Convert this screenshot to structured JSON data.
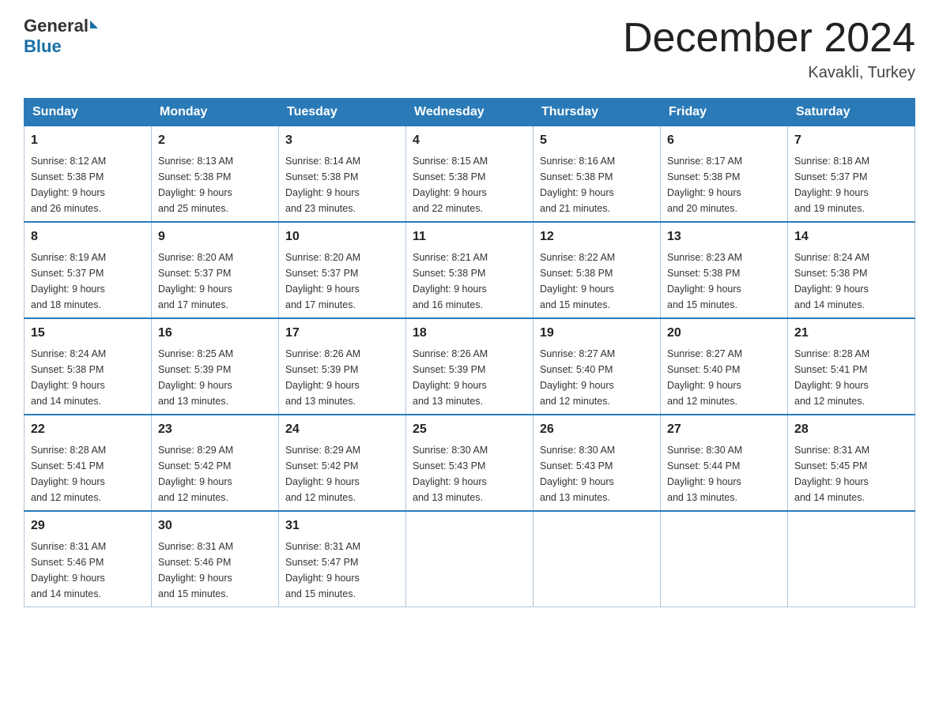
{
  "header": {
    "logo_general": "General",
    "logo_blue": "Blue",
    "month_title": "December 2024",
    "location": "Kavakli, Turkey"
  },
  "weekdays": [
    "Sunday",
    "Monday",
    "Tuesday",
    "Wednesday",
    "Thursday",
    "Friday",
    "Saturday"
  ],
  "weeks": [
    [
      {
        "day": "1",
        "sunrise": "8:12 AM",
        "sunset": "5:38 PM",
        "daylight": "9 hours and 26 minutes."
      },
      {
        "day": "2",
        "sunrise": "8:13 AM",
        "sunset": "5:38 PM",
        "daylight": "9 hours and 25 minutes."
      },
      {
        "day": "3",
        "sunrise": "8:14 AM",
        "sunset": "5:38 PM",
        "daylight": "9 hours and 23 minutes."
      },
      {
        "day": "4",
        "sunrise": "8:15 AM",
        "sunset": "5:38 PM",
        "daylight": "9 hours and 22 minutes."
      },
      {
        "day": "5",
        "sunrise": "8:16 AM",
        "sunset": "5:38 PM",
        "daylight": "9 hours and 21 minutes."
      },
      {
        "day": "6",
        "sunrise": "8:17 AM",
        "sunset": "5:38 PM",
        "daylight": "9 hours and 20 minutes."
      },
      {
        "day": "7",
        "sunrise": "8:18 AM",
        "sunset": "5:37 PM",
        "daylight": "9 hours and 19 minutes."
      }
    ],
    [
      {
        "day": "8",
        "sunrise": "8:19 AM",
        "sunset": "5:37 PM",
        "daylight": "9 hours and 18 minutes."
      },
      {
        "day": "9",
        "sunrise": "8:20 AM",
        "sunset": "5:37 PM",
        "daylight": "9 hours and 17 minutes."
      },
      {
        "day": "10",
        "sunrise": "8:20 AM",
        "sunset": "5:37 PM",
        "daylight": "9 hours and 17 minutes."
      },
      {
        "day": "11",
        "sunrise": "8:21 AM",
        "sunset": "5:38 PM",
        "daylight": "9 hours and 16 minutes."
      },
      {
        "day": "12",
        "sunrise": "8:22 AM",
        "sunset": "5:38 PM",
        "daylight": "9 hours and 15 minutes."
      },
      {
        "day": "13",
        "sunrise": "8:23 AM",
        "sunset": "5:38 PM",
        "daylight": "9 hours and 15 minutes."
      },
      {
        "day": "14",
        "sunrise": "8:24 AM",
        "sunset": "5:38 PM",
        "daylight": "9 hours and 14 minutes."
      }
    ],
    [
      {
        "day": "15",
        "sunrise": "8:24 AM",
        "sunset": "5:38 PM",
        "daylight": "9 hours and 14 minutes."
      },
      {
        "day": "16",
        "sunrise": "8:25 AM",
        "sunset": "5:39 PM",
        "daylight": "9 hours and 13 minutes."
      },
      {
        "day": "17",
        "sunrise": "8:26 AM",
        "sunset": "5:39 PM",
        "daylight": "9 hours and 13 minutes."
      },
      {
        "day": "18",
        "sunrise": "8:26 AM",
        "sunset": "5:39 PM",
        "daylight": "9 hours and 13 minutes."
      },
      {
        "day": "19",
        "sunrise": "8:27 AM",
        "sunset": "5:40 PM",
        "daylight": "9 hours and 12 minutes."
      },
      {
        "day": "20",
        "sunrise": "8:27 AM",
        "sunset": "5:40 PM",
        "daylight": "9 hours and 12 minutes."
      },
      {
        "day": "21",
        "sunrise": "8:28 AM",
        "sunset": "5:41 PM",
        "daylight": "9 hours and 12 minutes."
      }
    ],
    [
      {
        "day": "22",
        "sunrise": "8:28 AM",
        "sunset": "5:41 PM",
        "daylight": "9 hours and 12 minutes."
      },
      {
        "day": "23",
        "sunrise": "8:29 AM",
        "sunset": "5:42 PM",
        "daylight": "9 hours and 12 minutes."
      },
      {
        "day": "24",
        "sunrise": "8:29 AM",
        "sunset": "5:42 PM",
        "daylight": "9 hours and 12 minutes."
      },
      {
        "day": "25",
        "sunrise": "8:30 AM",
        "sunset": "5:43 PM",
        "daylight": "9 hours and 13 minutes."
      },
      {
        "day": "26",
        "sunrise": "8:30 AM",
        "sunset": "5:43 PM",
        "daylight": "9 hours and 13 minutes."
      },
      {
        "day": "27",
        "sunrise": "8:30 AM",
        "sunset": "5:44 PM",
        "daylight": "9 hours and 13 minutes."
      },
      {
        "day": "28",
        "sunrise": "8:31 AM",
        "sunset": "5:45 PM",
        "daylight": "9 hours and 14 minutes."
      }
    ],
    [
      {
        "day": "29",
        "sunrise": "8:31 AM",
        "sunset": "5:46 PM",
        "daylight": "9 hours and 14 minutes."
      },
      {
        "day": "30",
        "sunrise": "8:31 AM",
        "sunset": "5:46 PM",
        "daylight": "9 hours and 15 minutes."
      },
      {
        "day": "31",
        "sunrise": "8:31 AM",
        "sunset": "5:47 PM",
        "daylight": "9 hours and 15 minutes."
      },
      null,
      null,
      null,
      null
    ]
  ],
  "labels": {
    "sunrise": "Sunrise:",
    "sunset": "Sunset:",
    "daylight": "Daylight:"
  }
}
